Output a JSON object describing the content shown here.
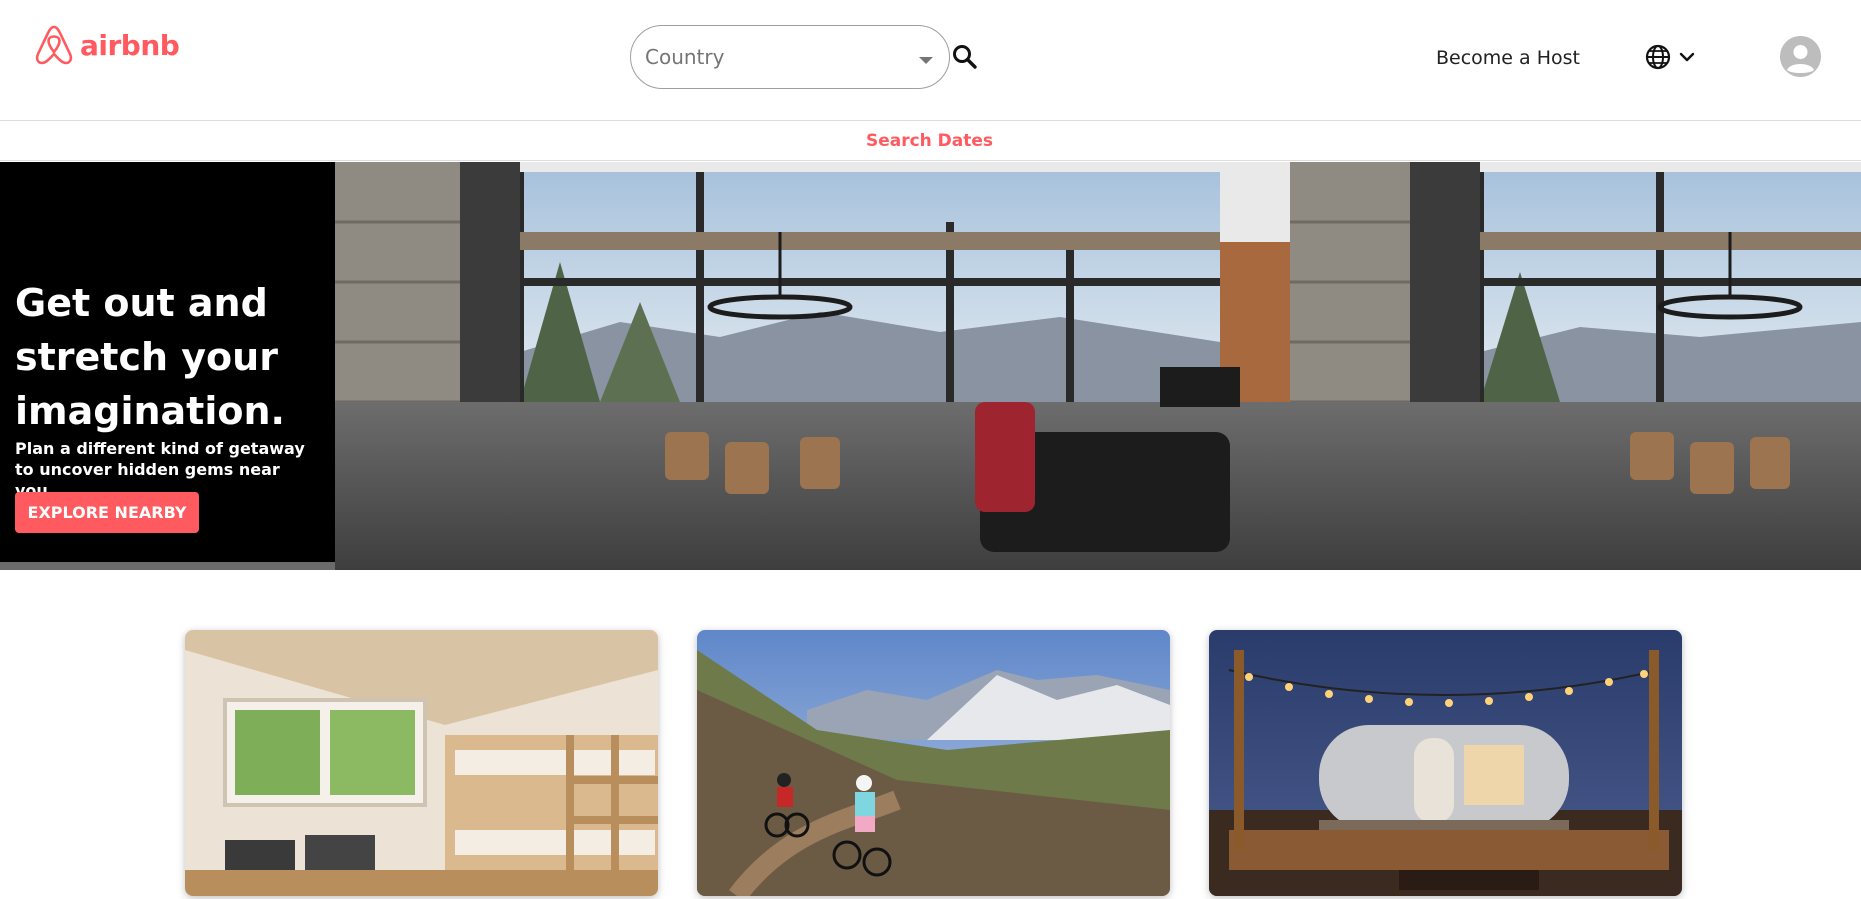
{
  "header": {
    "brand": "airbnb",
    "country_placeholder": "Country",
    "become_host": "Become a Host"
  },
  "subnav": {
    "search_dates": "Search Dates"
  },
  "hero": {
    "title": "Get out and stretch your imagination.",
    "subtitle": "Plan a different kind of getaway to uncover hidden gems near you.",
    "cta": "EXPLORE NEARBY"
  },
  "colors": {
    "brand": "#ff5a5f",
    "panel": "#000000",
    "border": "#dddddd"
  },
  "icons": {
    "search": "search-icon",
    "globe": "globe-icon",
    "chevron": "chevron-down-icon",
    "avatar": "user-avatar-icon"
  }
}
